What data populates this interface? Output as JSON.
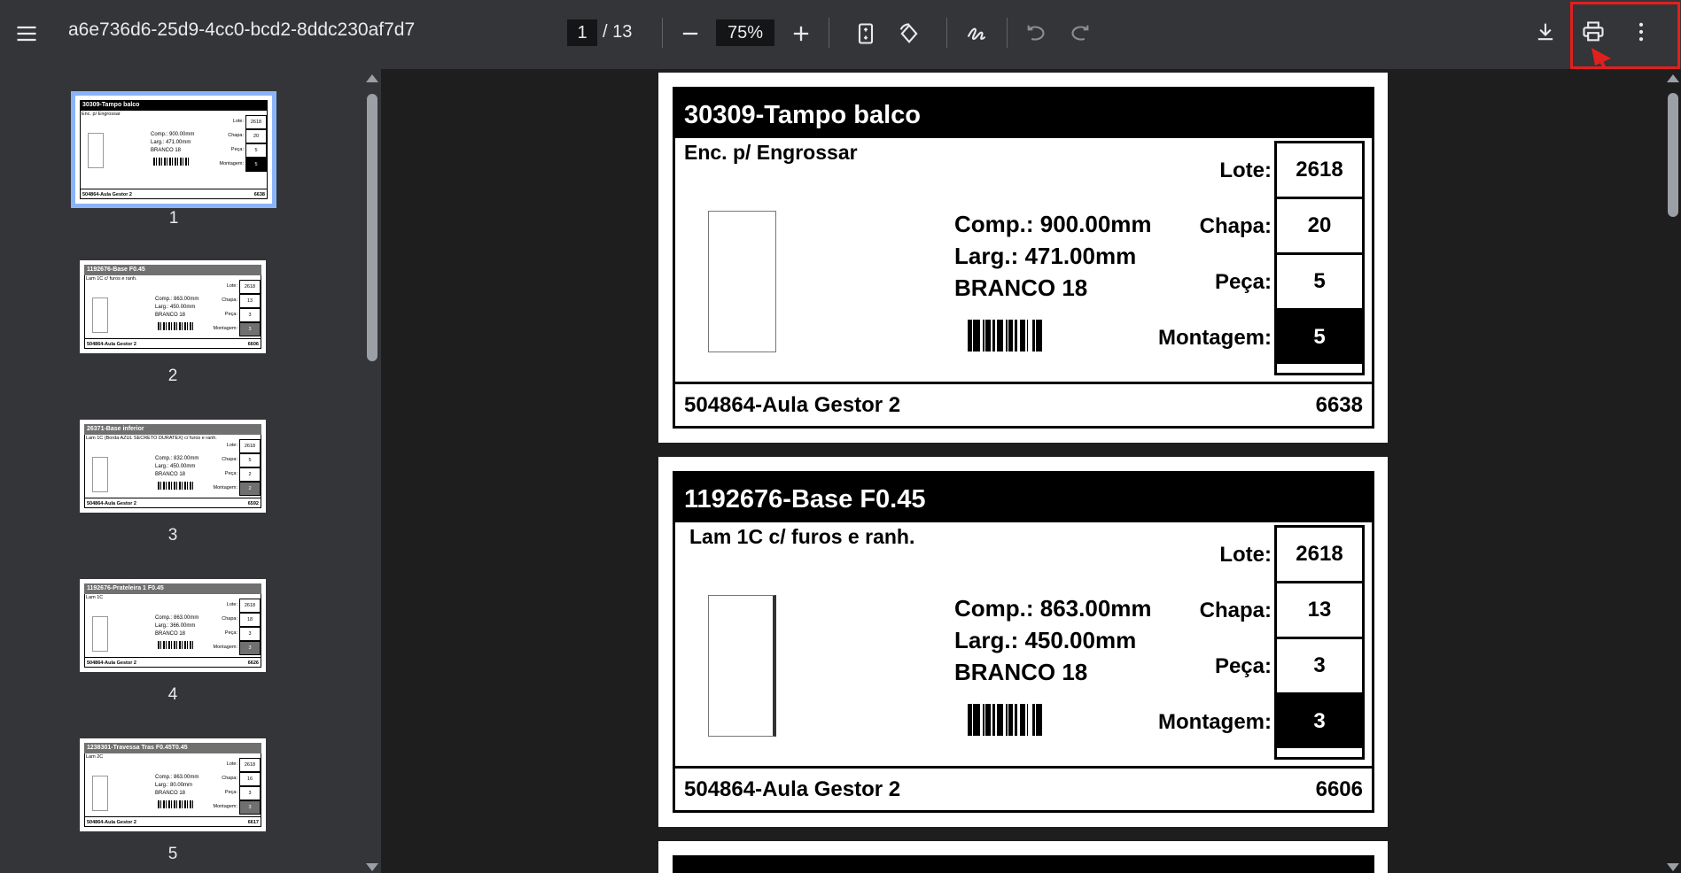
{
  "toolbar": {
    "title": "a6e736d6-25d9-4cc0-bcd2-8ddc230af7d7",
    "page_current": "1",
    "page_total": "/ 13",
    "zoom": "75%",
    "icons": [
      "menu-icon",
      "minus-icon",
      "plus-icon",
      "fit-page-icon",
      "rotate-icon",
      "draw-icon",
      "undo-icon",
      "redo-icon",
      "download-icon",
      "print-icon",
      "more-vert-icon"
    ]
  },
  "colors": {
    "toolbar_bg": "#333538",
    "viewer_bg": "#1e1e1e",
    "selected_thumb": "#8ab4f8",
    "highlight": "#e0201e"
  },
  "thumbnails": [
    {
      "num": "1",
      "title": "30309-Tampo balco",
      "sub": "Enc. p/ Engrossar",
      "comp": "Comp.: 900.00mm",
      "larg": "Larg.: 471.00mm",
      "mat": "BRANCO 18",
      "lote": "2618",
      "chapa": "20",
      "peca": "5",
      "mont": "5",
      "foot_l": "504864-Aula Gestor 2",
      "foot_r": "6638"
    },
    {
      "num": "2",
      "title": "1192676-Base F0.45",
      "sub": "Lam 1C c/ furos e ranh.",
      "comp": "Comp.: 863.00mm",
      "larg": "Larg.: 450.00mm",
      "mat": "BRANCO 18",
      "lote": "2618",
      "chapa": "13",
      "peca": "3",
      "mont": "3",
      "foot_l": "504864-Aula Gestor 2",
      "foot_r": "6606"
    },
    {
      "num": "3",
      "title": "26371-Base inferior",
      "sub": "Lam 1C (Borda AZUL SECRETO DURATEX) c/ furos e ranh.",
      "comp": "Comp.: 832.00mm",
      "larg": "Larg.: 450.00mm",
      "mat": "BRANCO 18",
      "lote": "2618",
      "chapa": "5",
      "peca": "2",
      "mont": "2",
      "foot_l": "504864-Aula Gestor 2",
      "foot_r": "6592"
    },
    {
      "num": "4",
      "title": "1192676-Prateleira 1 F0.45",
      "sub": "Lam 1C",
      "comp": "Comp.: 863.00mm",
      "larg": "Larg.: 366.00mm",
      "mat": "BRANCO 18",
      "lote": "2618",
      "chapa": "18",
      "peca": "3",
      "mont": "3",
      "foot_l": "504864-Aula Gestor 2",
      "foot_r": "6626"
    },
    {
      "num": "5",
      "title": "1238301-Travessa Tras F0.45T0.45",
      "sub": "Lam 2C",
      "comp": "Comp.: 863.00mm",
      "larg": "Larg.: 80.00mm",
      "mat": "BRANCO 18",
      "lote": "2618",
      "chapa": "16",
      "peca": "3",
      "mont": "3",
      "foot_l": "504864-Aula Gestor 2",
      "foot_r": "6617"
    }
  ],
  "keys": {
    "lote": "Lote:",
    "chapa": "Chapa:",
    "peca": "Peça:",
    "mont": "Montagem:"
  },
  "pages": [
    {
      "title": "30309-Tampo balco",
      "sub": "Enc. p/ Engrossar",
      "comp": "Comp.: 900.00mm",
      "larg": "Larg.: 471.00mm",
      "mat": "BRANCO 18",
      "lote": "2618",
      "chapa": "20",
      "peca": "5",
      "mont": "5",
      "foot_l": "504864-Aula Gestor 2",
      "foot_r": "6638"
    },
    {
      "title": "1192676-Base F0.45",
      "sub": "Lam 1C c/ furos e ranh.",
      "comp": "Comp.: 863.00mm",
      "larg": "Larg.: 450.00mm",
      "mat": "BRANCO 18",
      "lote": "2618",
      "chapa": "13",
      "peca": "3",
      "mont": "3",
      "foot_l": "504864-Aula Gestor 2",
      "foot_r": "6606"
    }
  ]
}
